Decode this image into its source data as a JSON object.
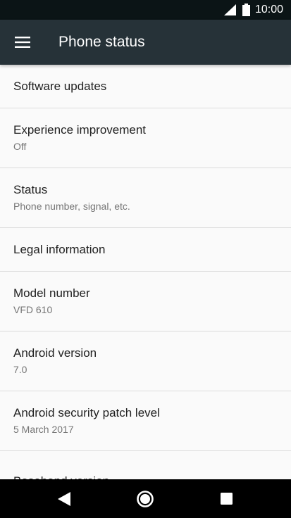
{
  "status_bar": {
    "time": "10:00",
    "icons": [
      "signal-icon",
      "battery-icon"
    ]
  },
  "toolbar": {
    "title": "Phone status",
    "menu_icon": "menu-icon"
  },
  "items": [
    {
      "primary": "Software updates",
      "secondary": ""
    },
    {
      "primary": "Experience improvement",
      "secondary": "Off"
    },
    {
      "primary": "Status",
      "secondary": "Phone number, signal, etc."
    },
    {
      "primary": "Legal information",
      "secondary": ""
    },
    {
      "primary": "Model number",
      "secondary": "VFD 610"
    },
    {
      "primary": "Android version",
      "secondary": "7.0"
    },
    {
      "primary": "Android security patch level",
      "secondary": "5 March 2017"
    },
    {
      "primary": "Baseband version",
      "secondary": ""
    }
  ],
  "nav_bar": {
    "icons": [
      "back-icon",
      "home-icon",
      "recents-icon"
    ]
  },
  "colors": {
    "status_bar": "#0b1416",
    "toolbar": "#263238",
    "background": "#fafafa",
    "primary_text": "#212121",
    "secondary_text": "#757575",
    "divider": "#dcdcdc"
  }
}
